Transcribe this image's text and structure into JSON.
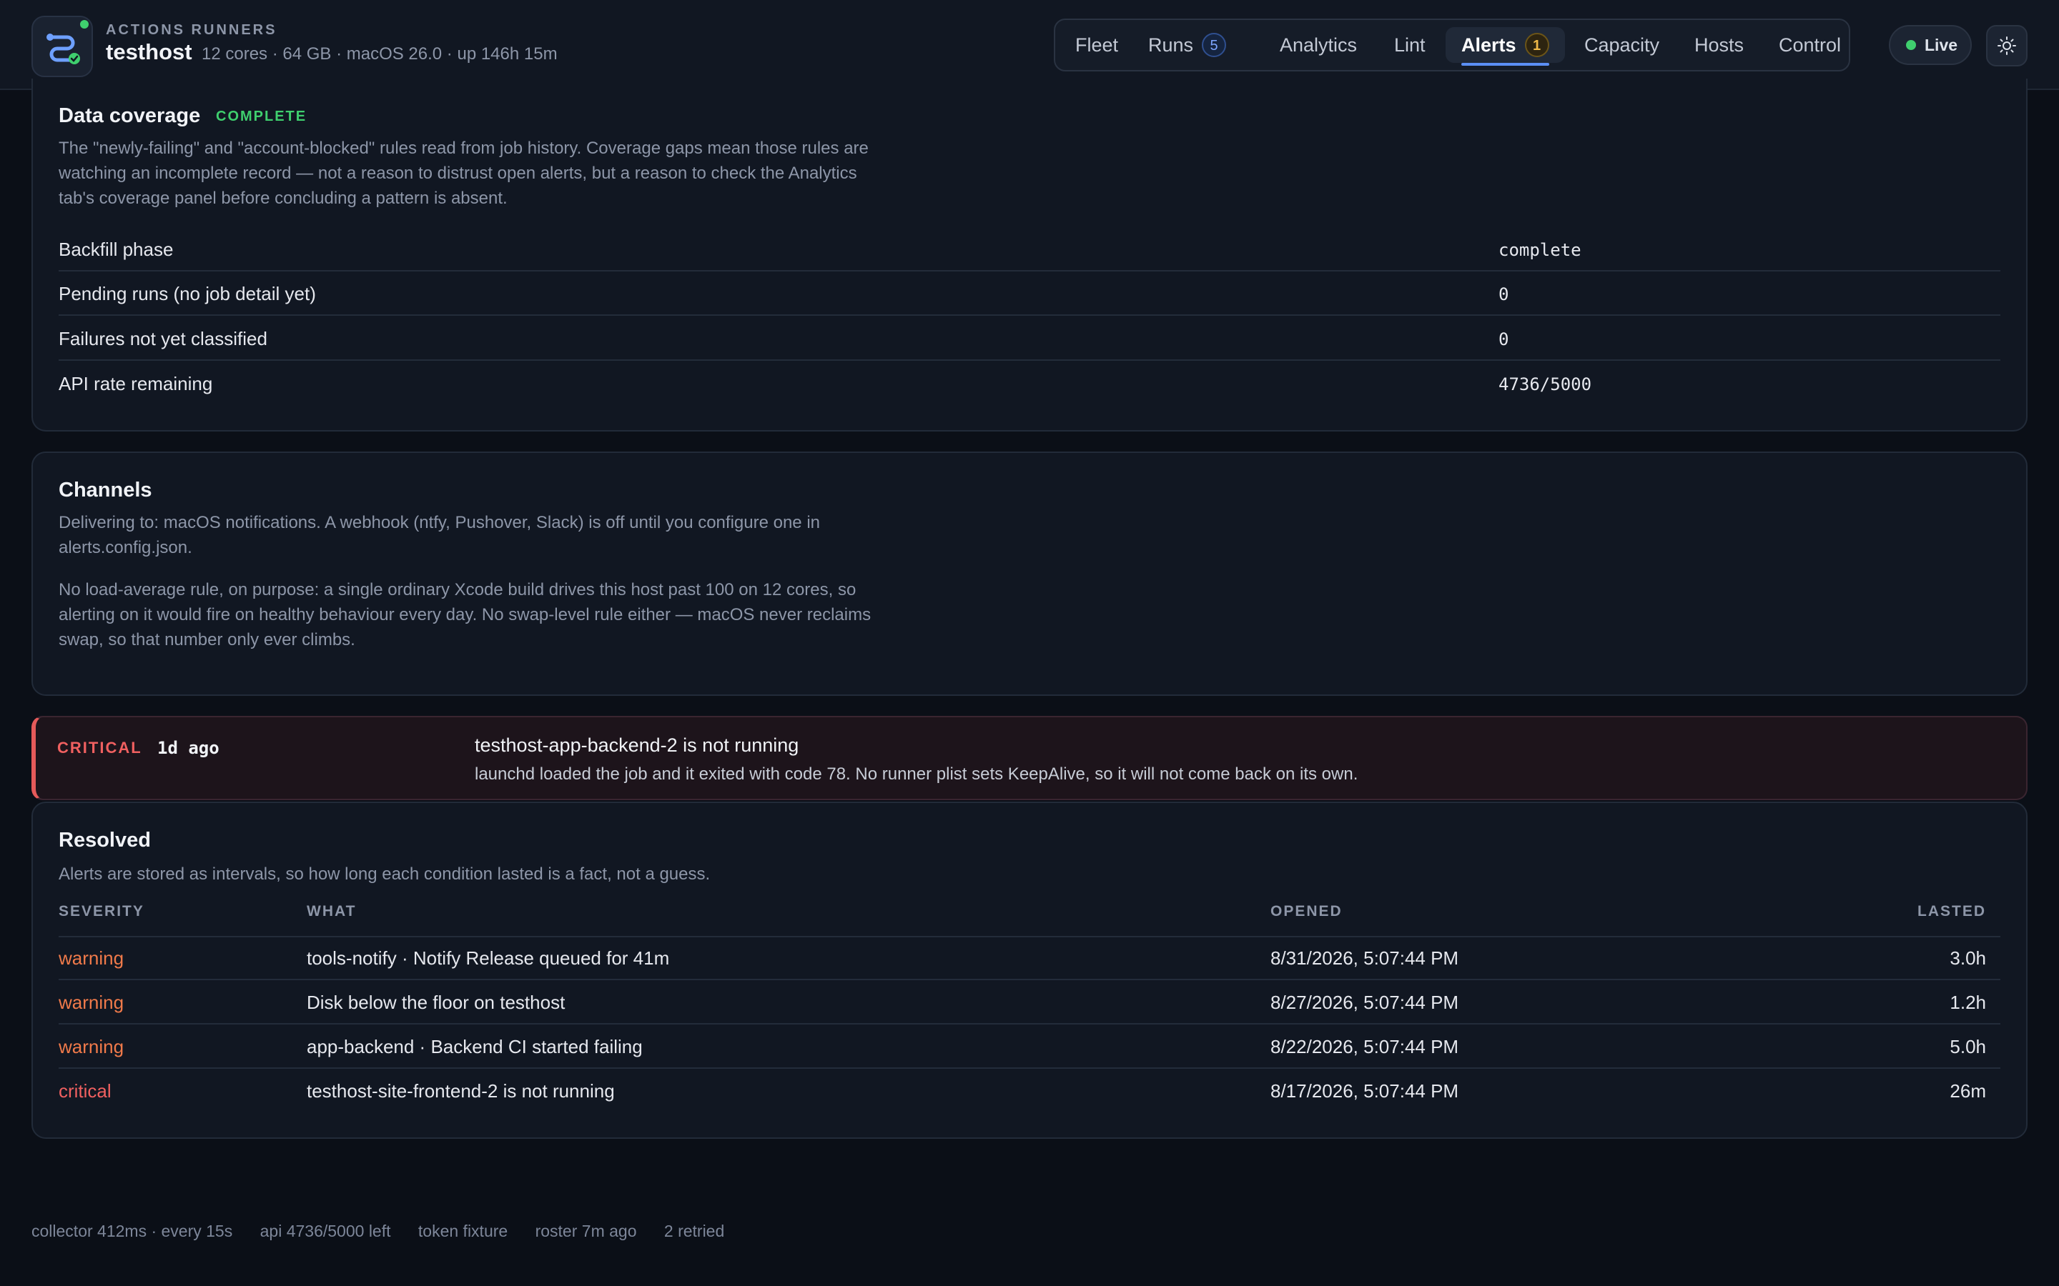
{
  "header": {
    "eyebrow": "ACTIONS RUNNERS",
    "host": "testhost",
    "meta": "12 cores · 64 GB · macOS 26.0 · up 146h 15m",
    "nav": [
      {
        "label": "Fleet"
      },
      {
        "label": "Runs",
        "count": "5"
      },
      {
        "label": "Analytics"
      },
      {
        "label": "Lint"
      },
      {
        "label": "Alerts",
        "count": "1",
        "active": true
      },
      {
        "label": "Capacity"
      },
      {
        "label": "Hosts"
      },
      {
        "label": "Control"
      }
    ],
    "live_label": "Live",
    "icons": {
      "logo": "runner-logo-icon",
      "theme": "sun-icon",
      "status": "live-dot-icon"
    },
    "colors": {
      "accent": "#5b8ff5",
      "live": "#3fcf6e"
    }
  },
  "coverage": {
    "title": "Data coverage",
    "badge": "COMPLETE",
    "description": "The \"newly-failing\" and \"account-blocked\" rules read from job history. Coverage gaps mean those rules are watching an incomplete record — not a reason to distrust open alerts, but a reason to check the Analytics tab's coverage panel before concluding a pattern is absent.",
    "rows": [
      {
        "label": "Backfill phase",
        "value": "complete"
      },
      {
        "label": "Pending runs (no job detail yet)",
        "value": "0"
      },
      {
        "label": "Failures not yet classified",
        "value": "0"
      },
      {
        "label": "API rate remaining",
        "value": "4736/5000"
      }
    ]
  },
  "channels": {
    "title": "Channels",
    "paragraph1": "Delivering to: macOS notifications. A webhook (ntfy, Pushover, Slack) is off until you configure one in alerts.config.json.",
    "paragraph2": "No load-average rule, on purpose: a single ordinary Xcode build drives this host past 100 on 12 cores, so alerting on it would fire on healthy behaviour every day. No swap-level rule either — macOS never reclaims swap, so that number only ever climbs."
  },
  "open_alert": {
    "severity": "CRITICAL",
    "age": "1d ago",
    "title": "testhost-app-backend-2 is not running",
    "detail": "launchd loaded the job and it exited with code 78. No runner plist sets KeepAlive, so it will not come back on its own.",
    "color": "#e55a5a"
  },
  "resolved": {
    "title": "Resolved",
    "description": "Alerts are stored as intervals, so how long each condition lasted is a fact, not a guess.",
    "columns": {
      "severity": "SEVERITY",
      "what": "WHAT",
      "opened": "OPENED",
      "lasted": "LASTED"
    },
    "rows": [
      {
        "severity": "warning",
        "what": "tools-notify · Notify Release queued for 41m",
        "opened": "8/31/2026, 5:07:44 PM",
        "lasted": "3.0h"
      },
      {
        "severity": "warning",
        "what": "Disk below the floor on testhost",
        "opened": "8/27/2026, 5:07:44 PM",
        "lasted": "1.2h"
      },
      {
        "severity": "warning",
        "what": "app-backend · Backend CI started failing",
        "opened": "8/22/2026, 5:07:44 PM",
        "lasted": "5.0h"
      },
      {
        "severity": "critical",
        "what": "testhost-site-frontend-2 is not running",
        "opened": "8/17/2026, 5:07:44 PM",
        "lasted": "26m"
      }
    ]
  },
  "footer": {
    "collector": "collector 412ms · every 15s",
    "api": "api 4736/5000 left",
    "token": "token fixture",
    "roster": "roster 7m ago",
    "retried": "2 retried"
  }
}
